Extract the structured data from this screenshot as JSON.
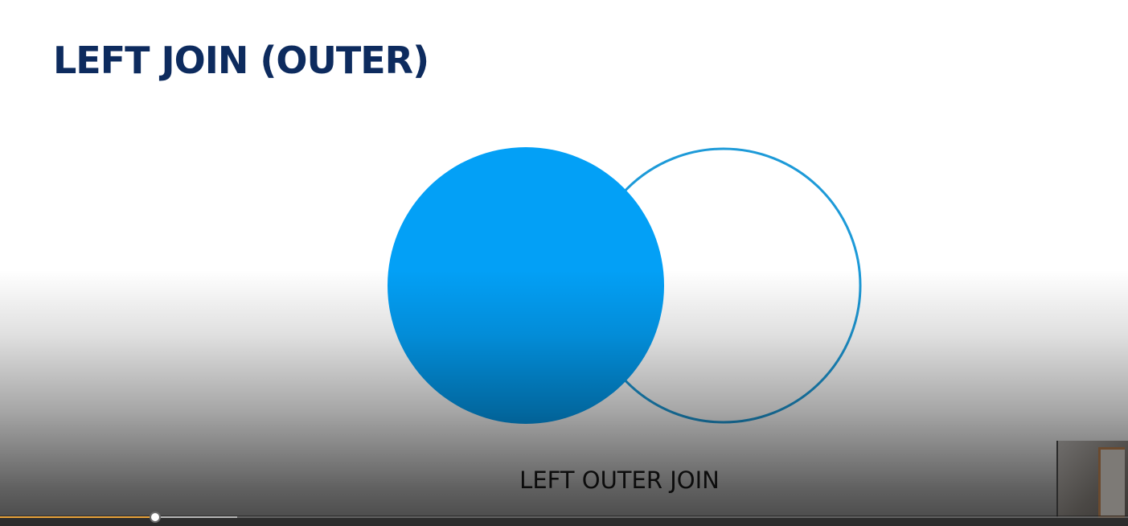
{
  "slide": {
    "title": "LEFT JOIN (OUTER)",
    "caption": "LEFT OUTER JOIN"
  },
  "colors": {
    "title": "#0d2b5e",
    "circle_fill": "#03a0f6",
    "circle_outline": "#1d9ad8"
  },
  "player": {
    "played_fraction": 0.136,
    "buffered_fraction": 0.21
  }
}
